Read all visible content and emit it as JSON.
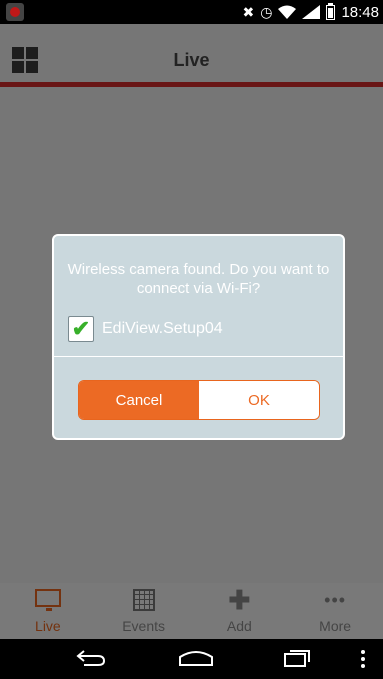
{
  "status_bar": {
    "time": "18:48",
    "icons": [
      "app-notification-icon",
      "mute-icon",
      "alarm-icon",
      "wifi-icon",
      "signal-icon",
      "battery-icon"
    ]
  },
  "header": {
    "title": "Live"
  },
  "dialog": {
    "message": "Wireless camera found. Do you want to connect via Wi-Fi?",
    "network": {
      "checked": true,
      "label": "EdiView.Setup04"
    },
    "cancel_label": "Cancel",
    "ok_label": "OK"
  },
  "tabs": [
    {
      "label": "Live",
      "icon": "monitor-icon",
      "active": true
    },
    {
      "label": "Events",
      "icon": "calendar-icon",
      "active": false
    },
    {
      "label": "Add",
      "icon": "plus-icon",
      "active": false
    },
    {
      "label": "More",
      "icon": "more-dots-icon",
      "active": false
    }
  ],
  "colors": {
    "accent": "#ec6a24",
    "header_stripe": "#d22a2a",
    "dialog_bg": "#cad8dd",
    "check": "#38b02a"
  }
}
